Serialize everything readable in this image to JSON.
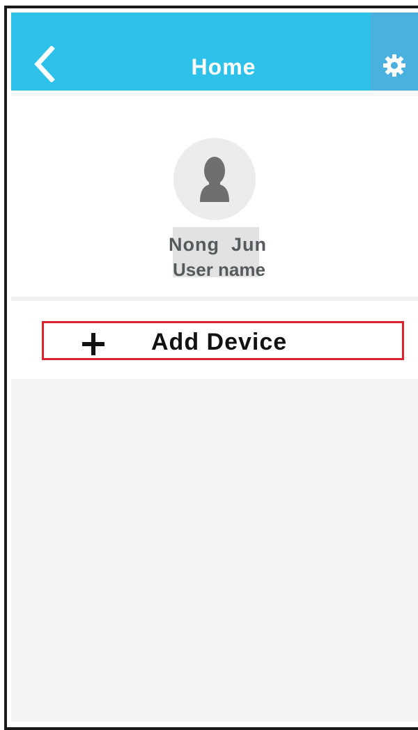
{
  "header": {
    "title": "Home",
    "back_icon": "chevron-left-icon",
    "settings_icon": "gear-icon"
  },
  "profile": {
    "avatar_icon": "user-silhouette-icon",
    "name": "Nong  Jun",
    "label": "User name"
  },
  "actions": {
    "add_icon": "plus-icon",
    "add_device_label": "Add Device"
  },
  "colors": {
    "header": "#2ec2ea",
    "highlight": "#d8232f"
  }
}
